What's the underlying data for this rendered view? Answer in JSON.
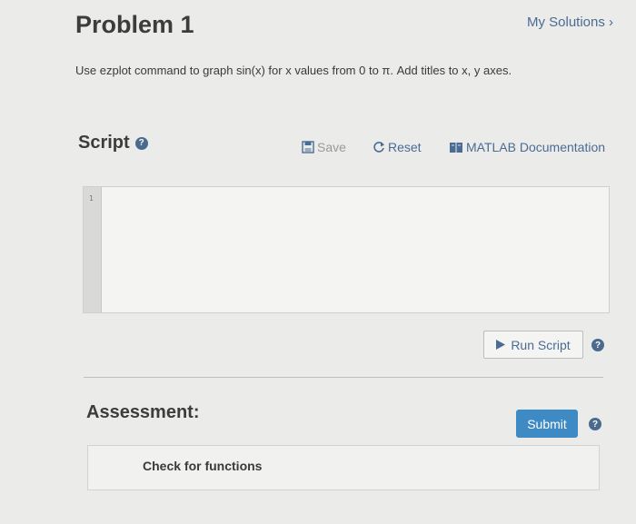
{
  "problem": {
    "title": "Problem 1",
    "my_solutions": "My Solutions",
    "my_solutions_chevron": "›",
    "description": "Use ezplot command to graph sin(x) for x values from 0 to π. Add titles to x, y axes."
  },
  "script": {
    "label": "Script",
    "help_glyph": "?",
    "save_label": "Save",
    "reset_label": "Reset",
    "doc_label": "MATLAB Documentation",
    "line_numbers": [
      "1"
    ],
    "content": "",
    "run_label": "Run Script"
  },
  "assessment": {
    "label": "Assessment:",
    "submit_label": "Submit",
    "check_text": "Check for functions"
  },
  "colors": {
    "accent": "#4a6c94",
    "submit_bg": "#3d8ac4",
    "help_icon": "#4a6a8e"
  },
  "icons": {
    "save": "save-icon",
    "reset": "reset-icon",
    "doc": "documentation-icon",
    "run": "play-icon",
    "help": "help-icon"
  }
}
